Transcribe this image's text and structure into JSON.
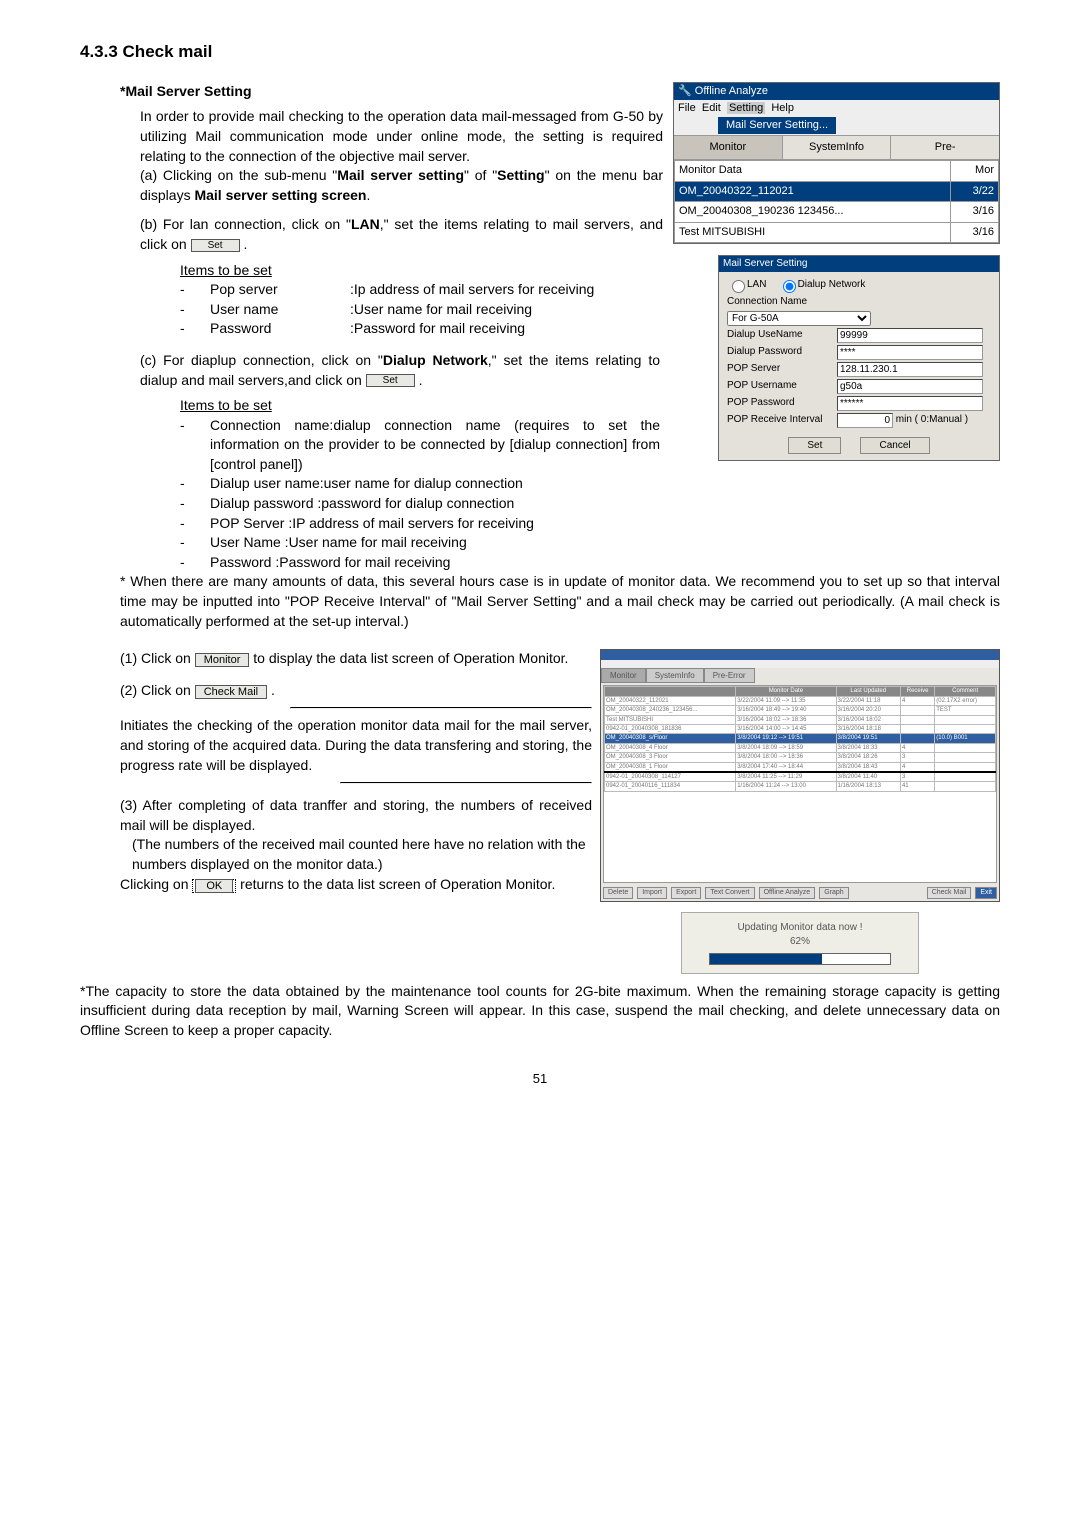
{
  "heading": "4.3.3 Check mail",
  "mail_server_setting": {
    "title": "*Mail Server Setting",
    "intro": "In order to provide mail checking to the operation data mail-messaged from G-50 by utilizing Mail communication mode under online mode, the setting is required relating to the connection of the objective mail server.",
    "a": "(a) Clicking on the sub-menu \"Mail server setting\" of \"Setting\" on the menu bar displays Mail server setting screen.",
    "b_pre": "(b) For lan connection, click on \"LAN,\" set the items relating to mail servers, and click on ",
    "b_post": " .",
    "items_header": "Items to be set",
    "items_b": [
      {
        "label": "Pop server",
        "desc": ":Ip address of mail servers for receiving"
      },
      {
        "label": "User name",
        "desc": ":User name for mail receiving"
      },
      {
        "label": "Password",
        "desc": ":Password for mail receiving"
      }
    ],
    "c_pre": "(c) For diaplup connection, click on \"Dialup Network,\" set the items relating to dialup and mail servers,and click on ",
    "c_post": " .",
    "items_c": [
      {
        "text": "Connection name:dialup connection name (requires to set the information on the provider to be connected by [dialup connection] from [control panel])"
      },
      {
        "text": "Dialup user name:user name for dialup connection"
      },
      {
        "text": "Dialup password :password for dialup connection"
      },
      {
        "text": "POP Server         :IP address of mail servers for receiving"
      },
      {
        "text": "User Name          :User name for mail receiving"
      },
      {
        "text": "Password            :Password for mail receiving"
      }
    ],
    "note": "* When there are many amounts of data, this several hours case is in update of monitor data. We recommend you to set up so that interval time may be inputted into \"POP Receive Interval\" of \"Mail Server Setting\" and a mail check may be carried out periodically. (A mail check is automatically performed at the set-up interval.)"
  },
  "steps": {
    "s1_pre": "(1) Click on ",
    "s1_post": " to display the data list screen of Operation Monitor.",
    "s2_pre": "(2) Click on ",
    "s2_post": " .",
    "s2_body": "Initiates the checking of the operation monitor data mail for the mail server, and storing of the acquired data. During the data transfering and storing, the progress rate will be displayed.",
    "s3": "(3) After completing of data tranffer and storing, the numbers of received mail will be displayed.",
    "s3_sub1": "(The numbers of the received mail counted here have no relation with the numbers displayed on the monitor data.)",
    "s3_sub2_pre": "Clicking on ",
    "s3_sub2_post": " returns to the data list screen of Operation Monitor."
  },
  "footnote": "*The capacity to store the data obtained by the maintenance tool counts for 2G-bite maximum. When the remaining storage capacity is getting insufficient during data reception by mail, Warning Screen will appear. In this case, suspend the mail checking, and delete unnecessary data on Offline Screen to keep a proper capacity.",
  "pageno": "51",
  "buttons": {
    "set": "Set",
    "monitor": "Monitor",
    "checkmail": "Check Mail",
    "ok": "OK"
  },
  "fig1": {
    "title": "Offline Analyze",
    "menu": [
      "File",
      "Edit",
      "Setting",
      "Help"
    ],
    "dropdown": "Mail Server Setting...",
    "tabs": [
      "Monitor",
      "SystemInfo",
      "Pre-"
    ],
    "rows": [
      {
        "c1": "Monitor Data",
        "c2": "Mor"
      },
      {
        "c1": "OM_20040322_112021",
        "c2": "3/22",
        "sel": true
      },
      {
        "c1": "OM_20040308_190236 123456...",
        "c2": "3/16"
      },
      {
        "c1": "Test MITSUBISHI",
        "c2": "3/16"
      }
    ]
  },
  "fig2": {
    "title": "Mail Server Setting",
    "radio_lan": "LAN",
    "radio_dial": "Dialup Network",
    "rows": [
      {
        "label": "Connection Name",
        "value": "For G-50A",
        "type": "select"
      },
      {
        "label": "Dialup UseName",
        "value": "99999"
      },
      {
        "label": "Dialup Password",
        "value": "****"
      },
      {
        "label": "POP Server",
        "value": "128.11.230.1"
      },
      {
        "label": "POP Username",
        "value": "g50a"
      },
      {
        "label": "POP Password",
        "value": "******"
      },
      {
        "label": "POP Receive Interval",
        "value": "0",
        "suffix": "min ( 0:Manual )"
      }
    ],
    "btn_set": "Set",
    "btn_cancel": "Cancel"
  },
  "fig3": {
    "tabs": [
      "Monitor",
      "SystemInfo",
      "Pre-Error"
    ],
    "cols": [
      "",
      "Monitor Date",
      "Last Updated",
      "Receive",
      "Comment"
    ],
    "rows": [
      [
        "OM_20040322_112021",
        "3/22/2004 11:09 --> 11:35",
        "3/22/2004 11:18",
        "4",
        "(02.17X2 error)"
      ],
      [
        "OM_20040308_240236_123456...",
        "3/16/2004 18:49 --> 19:40",
        "3/16/2004 20:20",
        "",
        "TEST"
      ],
      [
        "Test MITSUBISHI",
        "3/16/2004 18:02 --> 18:36",
        "3/16/2004 18:02",
        "",
        ""
      ],
      [
        "0942-01_20040308_181836",
        "3/16/2004 14:00 --> 14:45",
        "3/16/2004 18:18",
        "",
        ""
      ]
    ],
    "hl": [
      "OM_20040308_s/Floor",
      "3/8/2004 19:12 --> 19:51",
      "3/8/2004 19:51",
      "",
      "(10.0) B001"
    ],
    "rows2": [
      [
        "OM_20040308_4 Floor",
        "3/8/2004 18:09 --> 18:59",
        "3/8/2004 18:33",
        "4",
        ""
      ],
      [
        "OM_20040308_3 Floor",
        "3/8/2004 18:00 --> 18:36",
        "3/8/2004 18:26",
        "3",
        ""
      ],
      [
        "OM_20040308_1 Floor",
        "3/8/2004 17:40 --> 18:44",
        "3/8/2004 18:43",
        "4",
        ""
      ]
    ],
    "rows3": [
      [
        "0942-01_20040308_114127",
        "3/8/2004 11:25 --> 11:29",
        "3/8/2004 11:40",
        "3",
        ""
      ],
      [
        "0942-01_20040116_111834",
        "1/16/2004 11:24 --> 13:00",
        "1/16/2004 18:13",
        "41",
        ""
      ]
    ],
    "tools": [
      "Delete",
      "Import",
      "Export",
      "Text Convert",
      "Offline Analyze",
      "Graph",
      "Check Mail",
      "Exit"
    ],
    "progress_title": "Updating Monitor data now !",
    "progress_pct": "62%"
  }
}
